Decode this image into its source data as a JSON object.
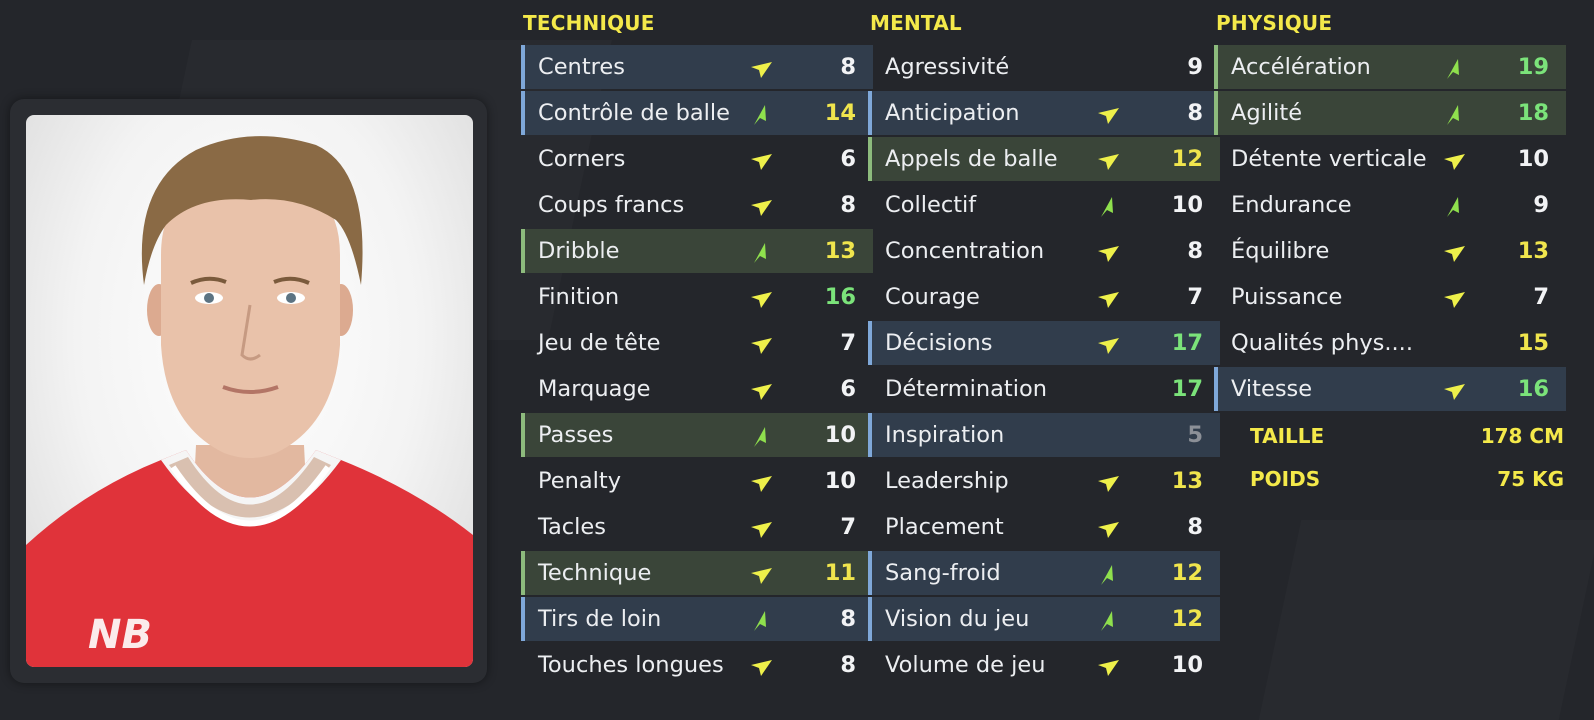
{
  "columns": [
    {
      "title": "TECHNIQUE",
      "rows": [
        {
          "name": "Centres",
          "value": "8",
          "arrow": "right",
          "highlight": "blue",
          "value_color": "white"
        },
        {
          "name": "Contrôle de balle",
          "value": "14",
          "arrow": "up",
          "highlight": "blue",
          "value_color": "yellow"
        },
        {
          "name": "Corners",
          "value": "6",
          "arrow": "right",
          "highlight": "none",
          "value_color": "white"
        },
        {
          "name": "Coups francs",
          "value": "8",
          "arrow": "right",
          "highlight": "none",
          "value_color": "white"
        },
        {
          "name": "Dribble",
          "value": "13",
          "arrow": "up",
          "highlight": "green",
          "value_color": "yellow"
        },
        {
          "name": "Finition",
          "value": "16",
          "arrow": "right",
          "highlight": "none",
          "value_color": "green"
        },
        {
          "name": "Jeu de tête",
          "value": "7",
          "arrow": "right",
          "highlight": "none",
          "value_color": "white"
        },
        {
          "name": "Marquage",
          "value": "6",
          "arrow": "right",
          "highlight": "none",
          "value_color": "white"
        },
        {
          "name": "Passes",
          "value": "10",
          "arrow": "up",
          "highlight": "green",
          "value_color": "white"
        },
        {
          "name": "Penalty",
          "value": "10",
          "arrow": "right",
          "highlight": "none",
          "value_color": "white"
        },
        {
          "name": "Tacles",
          "value": "7",
          "arrow": "right",
          "highlight": "none",
          "value_color": "white"
        },
        {
          "name": "Technique",
          "value": "11",
          "arrow": "right",
          "highlight": "green",
          "value_color": "yellow"
        },
        {
          "name": "Tirs de loin",
          "value": "8",
          "arrow": "up",
          "highlight": "blue",
          "value_color": "white"
        },
        {
          "name": "Touches longues",
          "value": "8",
          "arrow": "right",
          "highlight": "none",
          "value_color": "white"
        }
      ]
    },
    {
      "title": "MENTAL",
      "rows": [
        {
          "name": "Agressivité",
          "value": "9",
          "arrow": "none",
          "highlight": "none",
          "value_color": "white"
        },
        {
          "name": "Anticipation",
          "value": "8",
          "arrow": "right",
          "highlight": "blue",
          "value_color": "white"
        },
        {
          "name": "Appels de balle",
          "value": "12",
          "arrow": "right",
          "highlight": "green",
          "value_color": "yellow"
        },
        {
          "name": "Collectif",
          "value": "10",
          "arrow": "up",
          "highlight": "none",
          "value_color": "white"
        },
        {
          "name": "Concentration",
          "value": "8",
          "arrow": "right",
          "highlight": "none",
          "value_color": "white"
        },
        {
          "name": "Courage",
          "value": "7",
          "arrow": "right",
          "highlight": "none",
          "value_color": "white"
        },
        {
          "name": "Décisions",
          "value": "17",
          "arrow": "right",
          "highlight": "blue",
          "value_color": "green"
        },
        {
          "name": "Détermination",
          "value": "17",
          "arrow": "none",
          "highlight": "none",
          "value_color": "green"
        },
        {
          "name": "Inspiration",
          "value": "5",
          "arrow": "none",
          "highlight": "blue",
          "value_color": "grey"
        },
        {
          "name": "Leadership",
          "value": "13",
          "arrow": "right",
          "highlight": "none",
          "value_color": "yellow"
        },
        {
          "name": "Placement",
          "value": "8",
          "arrow": "right",
          "highlight": "none",
          "value_color": "white"
        },
        {
          "name": "Sang-froid",
          "value": "12",
          "arrow": "up",
          "highlight": "blue",
          "value_color": "yellow"
        },
        {
          "name": "Vision du jeu",
          "value": "12",
          "arrow": "up",
          "highlight": "blue",
          "value_color": "yellow"
        },
        {
          "name": "Volume de jeu",
          "value": "10",
          "arrow": "right",
          "highlight": "none",
          "value_color": "white"
        }
      ]
    },
    {
      "title": "PHYSIQUE",
      "rows": [
        {
          "name": "Accélération",
          "value": "19",
          "arrow": "up",
          "highlight": "green",
          "value_color": "green"
        },
        {
          "name": "Agilité",
          "value": "18",
          "arrow": "up",
          "highlight": "green",
          "value_color": "green"
        },
        {
          "name": "Détente verticale",
          "value": "10",
          "arrow": "right",
          "highlight": "none",
          "value_color": "white"
        },
        {
          "name": "Endurance",
          "value": "9",
          "arrow": "up",
          "highlight": "none",
          "value_color": "white"
        },
        {
          "name": "Équilibre",
          "value": "13",
          "arrow": "right",
          "highlight": "none",
          "value_color": "yellow"
        },
        {
          "name": "Puissance",
          "value": "7",
          "arrow": "right",
          "highlight": "none",
          "value_color": "white"
        },
        {
          "name": "Qualités phys....",
          "value": "15",
          "arrow": "none",
          "highlight": "none",
          "value_color": "yellow"
        },
        {
          "name": "Vitesse",
          "value": "16",
          "arrow": "right",
          "highlight": "blue",
          "value_color": "green"
        }
      ]
    }
  ],
  "player_info": {
    "height_label": "TAILLE",
    "height_value": "178 CM",
    "weight_label": "POIDS",
    "weight_value": "75 KG"
  },
  "colors": {
    "arrow_right": "#eef04a",
    "arrow_up": "#8fe04d",
    "title": "#f4e94a"
  }
}
